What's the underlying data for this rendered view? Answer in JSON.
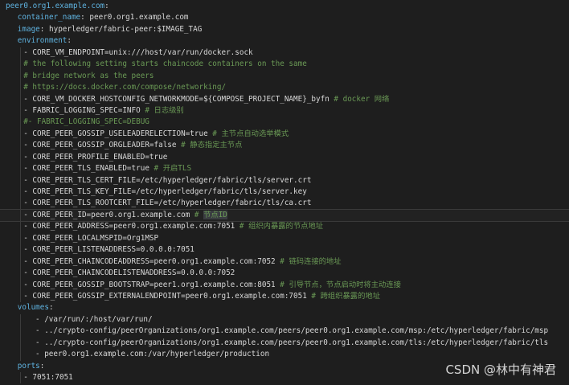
{
  "colors": {
    "background": "#1e1e1e",
    "key": "#5fb3e0",
    "string": "#d8d8d8",
    "comment": "#6a9955"
  },
  "watermark": "CSDN @林中有神君",
  "lines": [
    {
      "indent": 0,
      "parts": [
        {
          "t": "peer0.org1.example.com",
          "c": "k"
        },
        {
          "t": ":",
          "c": "p"
        }
      ]
    },
    {
      "indent": 2,
      "parts": [
        {
          "t": "container_name",
          "c": "k"
        },
        {
          "t": ": ",
          "c": "p"
        },
        {
          "t": "peer0.org1.example.com",
          "c": "s"
        }
      ]
    },
    {
      "indent": 2,
      "parts": [
        {
          "t": "image",
          "c": "k"
        },
        {
          "t": ": ",
          "c": "p"
        },
        {
          "t": "hyperledger/fabric-peer:$IMAGE_TAG",
          "c": "s"
        }
      ]
    },
    {
      "indent": 2,
      "parts": [
        {
          "t": "environment",
          "c": "k"
        },
        {
          "t": ":",
          "c": "p"
        }
      ]
    },
    {
      "indent": 3,
      "parts": [
        {
          "t": "- ",
          "c": "p"
        },
        {
          "t": "CORE_VM_ENDPOINT=unix:///host/var/run/docker.sock",
          "c": "s"
        }
      ]
    },
    {
      "indent": 3,
      "parts": [
        {
          "t": "# the following setting starts chaincode containers on the same",
          "c": "c"
        }
      ]
    },
    {
      "indent": 3,
      "parts": [
        {
          "t": "# bridge network as the peers",
          "c": "c"
        }
      ]
    },
    {
      "indent": 3,
      "parts": [
        {
          "t": "# https://docs.docker.com/compose/networking/",
          "c": "c"
        }
      ]
    },
    {
      "indent": 3,
      "parts": [
        {
          "t": "- ",
          "c": "p"
        },
        {
          "t": "CORE_VM_DOCKER_HOSTCONFIG_NETWORKMODE=${COMPOSE_PROJECT_NAME}_byfn ",
          "c": "s"
        },
        {
          "t": "# docker 网络",
          "c": "c"
        }
      ]
    },
    {
      "indent": 3,
      "parts": [
        {
          "t": "- ",
          "c": "p"
        },
        {
          "t": "FABRIC_LOGGING_SPEC=INFO ",
          "c": "s"
        },
        {
          "t": "# 日志级别",
          "c": "c"
        }
      ]
    },
    {
      "indent": 3,
      "parts": [
        {
          "t": "#- FABRIC_LOGGING_SPEC=DEBUG",
          "c": "c"
        }
      ]
    },
    {
      "indent": 3,
      "parts": [
        {
          "t": "- ",
          "c": "p"
        },
        {
          "t": "CORE_PEER_GOSSIP_USELEADERELECTION=true ",
          "c": "s"
        },
        {
          "t": "# 主节点自动选举模式",
          "c": "c"
        }
      ]
    },
    {
      "indent": 3,
      "parts": [
        {
          "t": "- ",
          "c": "p"
        },
        {
          "t": "CORE_PEER_GOSSIP_ORGLEADER=false ",
          "c": "s"
        },
        {
          "t": "# 静态指定主节点",
          "c": "c"
        }
      ]
    },
    {
      "indent": 3,
      "parts": [
        {
          "t": "- ",
          "c": "p"
        },
        {
          "t": "CORE_PEER_PROFILE_ENABLED=true",
          "c": "s"
        }
      ]
    },
    {
      "indent": 3,
      "parts": [
        {
          "t": "- ",
          "c": "p"
        },
        {
          "t": "CORE_PEER_TLS_ENABLED=true ",
          "c": "s"
        },
        {
          "t": "# 开启TLS",
          "c": "c"
        }
      ]
    },
    {
      "indent": 3,
      "parts": [
        {
          "t": "- ",
          "c": "p"
        },
        {
          "t": "CORE_PEER_TLS_CERT_FILE=/etc/hyperledger/fabric/tls/server.crt",
          "c": "s"
        }
      ]
    },
    {
      "indent": 3,
      "parts": [
        {
          "t": "- ",
          "c": "p"
        },
        {
          "t": "CORE_PEER_TLS_KEY_FILE=/etc/hyperledger/fabric/tls/server.key",
          "c": "s"
        }
      ]
    },
    {
      "indent": 3,
      "parts": [
        {
          "t": "- ",
          "c": "p"
        },
        {
          "t": "CORE_PEER_TLS_ROOTCERT_FILE=/etc/hyperledger/fabric/tls/ca.crt",
          "c": "s"
        }
      ]
    },
    {
      "indent": 3,
      "current": true,
      "parts": [
        {
          "t": "- ",
          "c": "p"
        },
        {
          "t": "CORE_PEER_ID=peer0.org1.example.com ",
          "c": "s"
        },
        {
          "t": "# ",
          "c": "c"
        },
        {
          "t": "节点ID",
          "c": "c hl"
        }
      ]
    },
    {
      "indent": 3,
      "parts": [
        {
          "t": "- ",
          "c": "p"
        },
        {
          "t": "CORE_PEER_ADDRESS=peer0.org1.example.com:7051 ",
          "c": "s"
        },
        {
          "t": "# 组织内暴露的节点地址",
          "c": "c"
        }
      ]
    },
    {
      "indent": 3,
      "parts": [
        {
          "t": "- ",
          "c": "p"
        },
        {
          "t": "CORE_PEER_LOCALMSPID=Org1MSP",
          "c": "s"
        }
      ]
    },
    {
      "indent": 3,
      "parts": [
        {
          "t": "- ",
          "c": "p"
        },
        {
          "t": "CORE_PEER_LISTENADDRESS=0.0.0.0:7051",
          "c": "s"
        }
      ]
    },
    {
      "indent": 3,
      "parts": [
        {
          "t": "- ",
          "c": "p"
        },
        {
          "t": "CORE_PEER_CHAINCODEADDRESS=peer0.org1.example.com:7052 ",
          "c": "s"
        },
        {
          "t": "# 链码连接的地址",
          "c": "c"
        }
      ]
    },
    {
      "indent": 3,
      "parts": [
        {
          "t": "- ",
          "c": "p"
        },
        {
          "t": "CORE_PEER_CHAINCODELISTENADDRESS=0.0.0.0:7052",
          "c": "s"
        }
      ]
    },
    {
      "indent": 3,
      "parts": [
        {
          "t": "- ",
          "c": "p"
        },
        {
          "t": "CORE_PEER_GOSSIP_BOOTSTRAP=peer1.org1.example.com:8051 ",
          "c": "s"
        },
        {
          "t": "# 引导节点，节点启动时将主动连接",
          "c": "c"
        }
      ]
    },
    {
      "indent": 3,
      "parts": [
        {
          "t": "- ",
          "c": "p"
        },
        {
          "t": "CORE_PEER_GOSSIP_EXTERNALENDPOINT=peer0.org1.example.com:7051 ",
          "c": "s"
        },
        {
          "t": "# 跨组织暴露的地址",
          "c": "c"
        }
      ]
    },
    {
      "indent": 2,
      "parts": [
        {
          "t": "volumes",
          "c": "k"
        },
        {
          "t": ":",
          "c": "p"
        }
      ]
    },
    {
      "indent": 5,
      "parts": [
        {
          "t": "- ",
          "c": "p"
        },
        {
          "t": "/var/run/:/host/var/run/",
          "c": "s"
        }
      ]
    },
    {
      "indent": 5,
      "parts": [
        {
          "t": "- ",
          "c": "p"
        },
        {
          "t": "../crypto-config/peerOrganizations/org1.example.com/peers/peer0.org1.example.com/msp:/etc/hyperledger/fabric/msp",
          "c": "s"
        }
      ]
    },
    {
      "indent": 5,
      "parts": [
        {
          "t": "- ",
          "c": "p"
        },
        {
          "t": "../crypto-config/peerOrganizations/org1.example.com/peers/peer0.org1.example.com/tls:/etc/hyperledger/fabric/tls",
          "c": "s"
        }
      ]
    },
    {
      "indent": 5,
      "parts": [
        {
          "t": "- ",
          "c": "p"
        },
        {
          "t": "peer0.org1.example.com:/var/hyperledger/production",
          "c": "s"
        }
      ]
    },
    {
      "indent": 2,
      "parts": [
        {
          "t": "ports",
          "c": "k"
        },
        {
          "t": ":",
          "c": "p"
        }
      ]
    },
    {
      "indent": 3,
      "parts": [
        {
          "t": "- ",
          "c": "p"
        },
        {
          "t": "7051:7051",
          "c": "s"
        }
      ]
    }
  ]
}
